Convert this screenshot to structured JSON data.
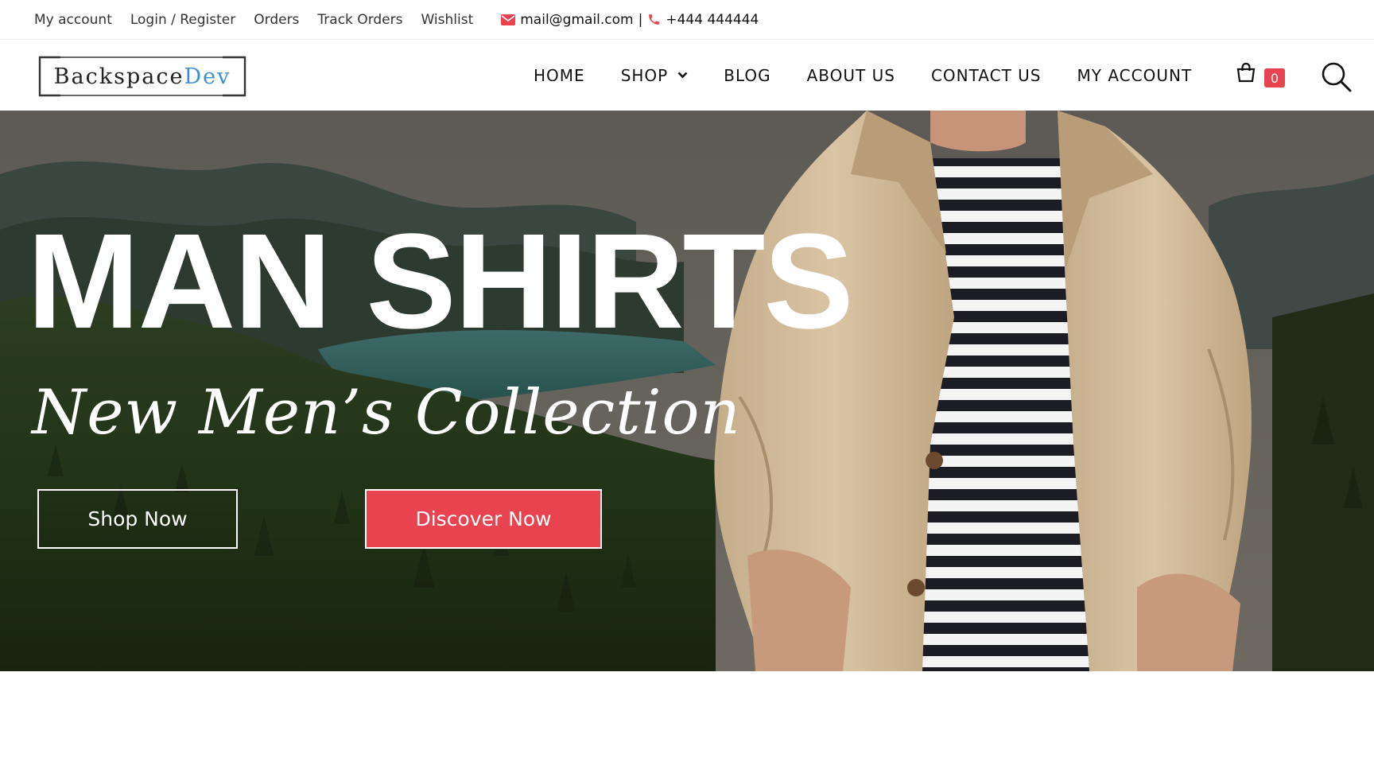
{
  "topbar": {
    "links": [
      "My account",
      "Login / Register",
      "Orders",
      "Track Orders",
      "Wishlist"
    ],
    "email": "mail@gmail.com",
    "separator": "|",
    "phone": "+444 444444"
  },
  "logo": {
    "main": "Backspace",
    "accent": "Dev"
  },
  "nav": {
    "items": [
      "HOME",
      "SHOP",
      "BLOG",
      "ABOUT US",
      "CONTACT US",
      "MY ACCOUNT"
    ]
  },
  "cart": {
    "count": "0"
  },
  "hero": {
    "title": "MAN SHIRTS",
    "subtitle": "New Men’s Collection",
    "shop_label": "Shop Now",
    "discover_label": "Discover Now"
  },
  "colors": {
    "accent": "#e8434e",
    "logo_accent": "#3b8fd6"
  },
  "icons": [
    "envelope-icon",
    "phone-icon",
    "chevron-down-icon",
    "shopping-bag-icon",
    "search-icon"
  ]
}
